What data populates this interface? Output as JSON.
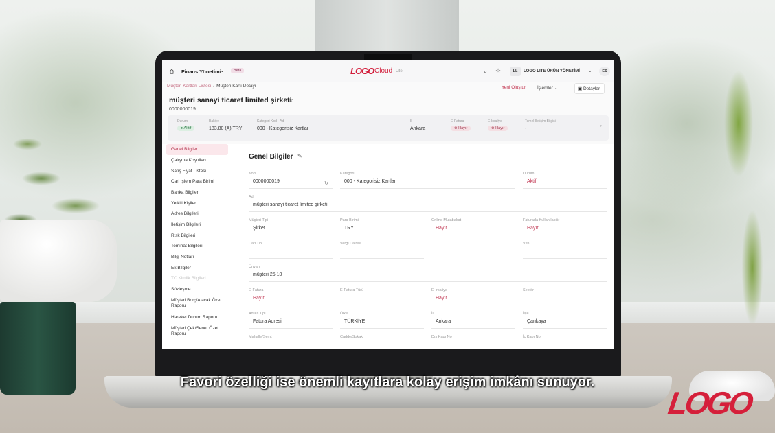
{
  "app": {
    "module": "Finans Yönetimi",
    "beta": "Beta",
    "logo": "LOGO",
    "product": "Cloud",
    "edition": "Lite",
    "org_initials": "LL",
    "org_name": "LOGO LITE ÜRÜN YÖNETİMİ",
    "user_initials": "ES",
    "brand_color": "#d21f3c"
  },
  "breadcrumb": {
    "list": "Müşteri Kartları Listesi",
    "separator": "/",
    "current": "Müşteri Kartı Detayı"
  },
  "actions": {
    "new": "Yeni Oluştur",
    "operations": "İşlemler",
    "details": "Detaylar"
  },
  "record": {
    "title": "müşteri sanayi ticaret limited şirketi",
    "code": "0000000019"
  },
  "summary": {
    "status_label": "Durum",
    "status": "Aktif",
    "balance_label": "Bakiye",
    "balance": "183,80 (A) TRY",
    "category_label": "Kategori Kod - Ad",
    "category": "000 - Kategorisiz Kartlar",
    "city_label": "İl",
    "city": "Ankara",
    "efatura_label": "E-Fatura",
    "efatura": "Hayır",
    "eirsaliye_label": "E-İrsaliye",
    "eirsaliye": "Hayır",
    "contact_label": "Temel İletişim Bilgisi",
    "contact": "-"
  },
  "sidebar": {
    "items": [
      "Genel Bilgiler",
      "Çalışma Koşulları",
      "Satış Fiyat Listesi",
      "Cari İşlem Para Birimi",
      "Banka Bilgileri",
      "Yetkili Kişiler",
      "Adres Bilgileri",
      "İletişim Bilgileri",
      "Risk Bilgileri",
      "Teminat Bilgileri",
      "Bilgi Notları",
      "Ek Bilgiler",
      "TC Kimlik Bilgileri",
      "Sözleşme",
      "Müşteri Borç/Alacak Özet Raporu",
      "Hareket Durum Raporu",
      "Müşteri Çek/Senet Özet Raporu"
    ]
  },
  "form": {
    "title": "Genel Bilgiler",
    "kod_label": "Kod",
    "kod": "0000000019",
    "kategori_label": "Kategori",
    "kategori": "000 - Kategorisiz Kartlar",
    "durum_label": "Durum",
    "durum": "Aktif",
    "ad_label": "Ad",
    "ad": "müşteri sanayi ticaret limited şirketi",
    "musteri_tipi_label": "Müşteri Tipi",
    "musteri_tipi": "Şirket",
    "para_birimi_label": "Para Birimi",
    "para_birimi": "TRY",
    "online_label": "Online Mutabakat",
    "online": "Hayır",
    "faturada_label": "Faturada Kullanılabilir",
    "faturada": "Hayır",
    "cari_tipi_label": "Cari Tipi",
    "cari_tipi": "",
    "vergi_label": "Vergi Dairesi",
    "vergi": "",
    "vkn_label": "Vkn",
    "vkn": "",
    "unvan_label": "Ünvan",
    "unvan": "müşteri 25.10",
    "efatura_label": "E-Fatura",
    "efatura": "Hayır",
    "efatura_turu_label": "E-Fatura Türü",
    "efatura_turu": "",
    "eirsaliye_label": "E-İrsaliye",
    "eirsaliye": "Hayır",
    "sektor_label": "Sektör",
    "sektor": "",
    "adres_tipi_label": "Adres Tipi",
    "adres_tipi": "Fatura Adresi",
    "ulke_label": "Ülke",
    "ulke": "TÜRKİYE",
    "il_label": "İl",
    "il": "Ankara",
    "ilce_label": "İlçe",
    "ilce": "Çankaya",
    "mahalle_label": "Mahalle/Semt",
    "cadde_label": "Cadde/Sokak",
    "dis_kapi_label": "Dış Kapı No",
    "ic_kapi_label": "İç Kapı No"
  },
  "subtitle": "Favori özelliği ise önemli kayıtlara kolay erişim imkânı sunuyor.",
  "brand_logo": "LOGO"
}
